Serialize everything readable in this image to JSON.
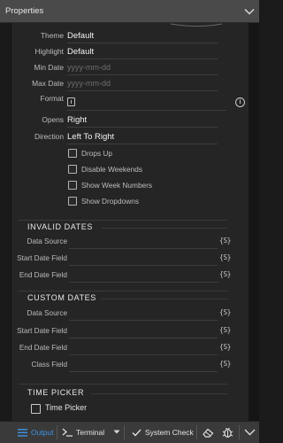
{
  "header": {
    "title": "Properties",
    "collapse_icon": "chevron-down-icon"
  },
  "fields": {
    "theme": {
      "label": "Theme",
      "value": "Default"
    },
    "highlight": {
      "label": "Highlight",
      "value": "Default"
    },
    "min_date": {
      "label": "Min Date",
      "placeholder": "yyyy-mm-dd"
    },
    "max_date": {
      "label": "Max Date",
      "placeholder": "yyyy-mm-dd"
    },
    "format": {
      "label": "Format"
    },
    "opens": {
      "label": "Opens",
      "value": "Right"
    },
    "direction": {
      "label": "Direction",
      "value": "Left To Right"
    }
  },
  "checkboxes": [
    {
      "label": "Drops Up",
      "checked": false
    },
    {
      "label": "Disable Weekends",
      "checked": false
    },
    {
      "label": "Show Week Numbers",
      "checked": false
    },
    {
      "label": "Show Dropdowns",
      "checked": false
    }
  ],
  "invalid_dates": {
    "title": "INVALID DATES",
    "rows": [
      {
        "label": "Data Source",
        "icon": "{S}"
      },
      {
        "label": "Start Date Field",
        "icon": "{S}"
      },
      {
        "label": "End Date Field",
        "icon": "{S}"
      }
    ]
  },
  "custom_dates": {
    "title": "CUSTOM DATES",
    "rows": [
      {
        "label": "Data Source",
        "icon": "{S}"
      },
      {
        "label": "Start Date Field",
        "icon": "{S}"
      },
      {
        "label": "End Date Field",
        "icon": "{S}"
      },
      {
        "label": "Class Field",
        "icon": "{S}"
      }
    ]
  },
  "time_picker": {
    "title": "TIME PICKER",
    "checkbox_label": "Time Picker"
  },
  "footer": {
    "output_label": "Output",
    "terminal_label": "Terminal",
    "system_check_label": "System Check",
    "accent_color": "#3e94e4"
  }
}
